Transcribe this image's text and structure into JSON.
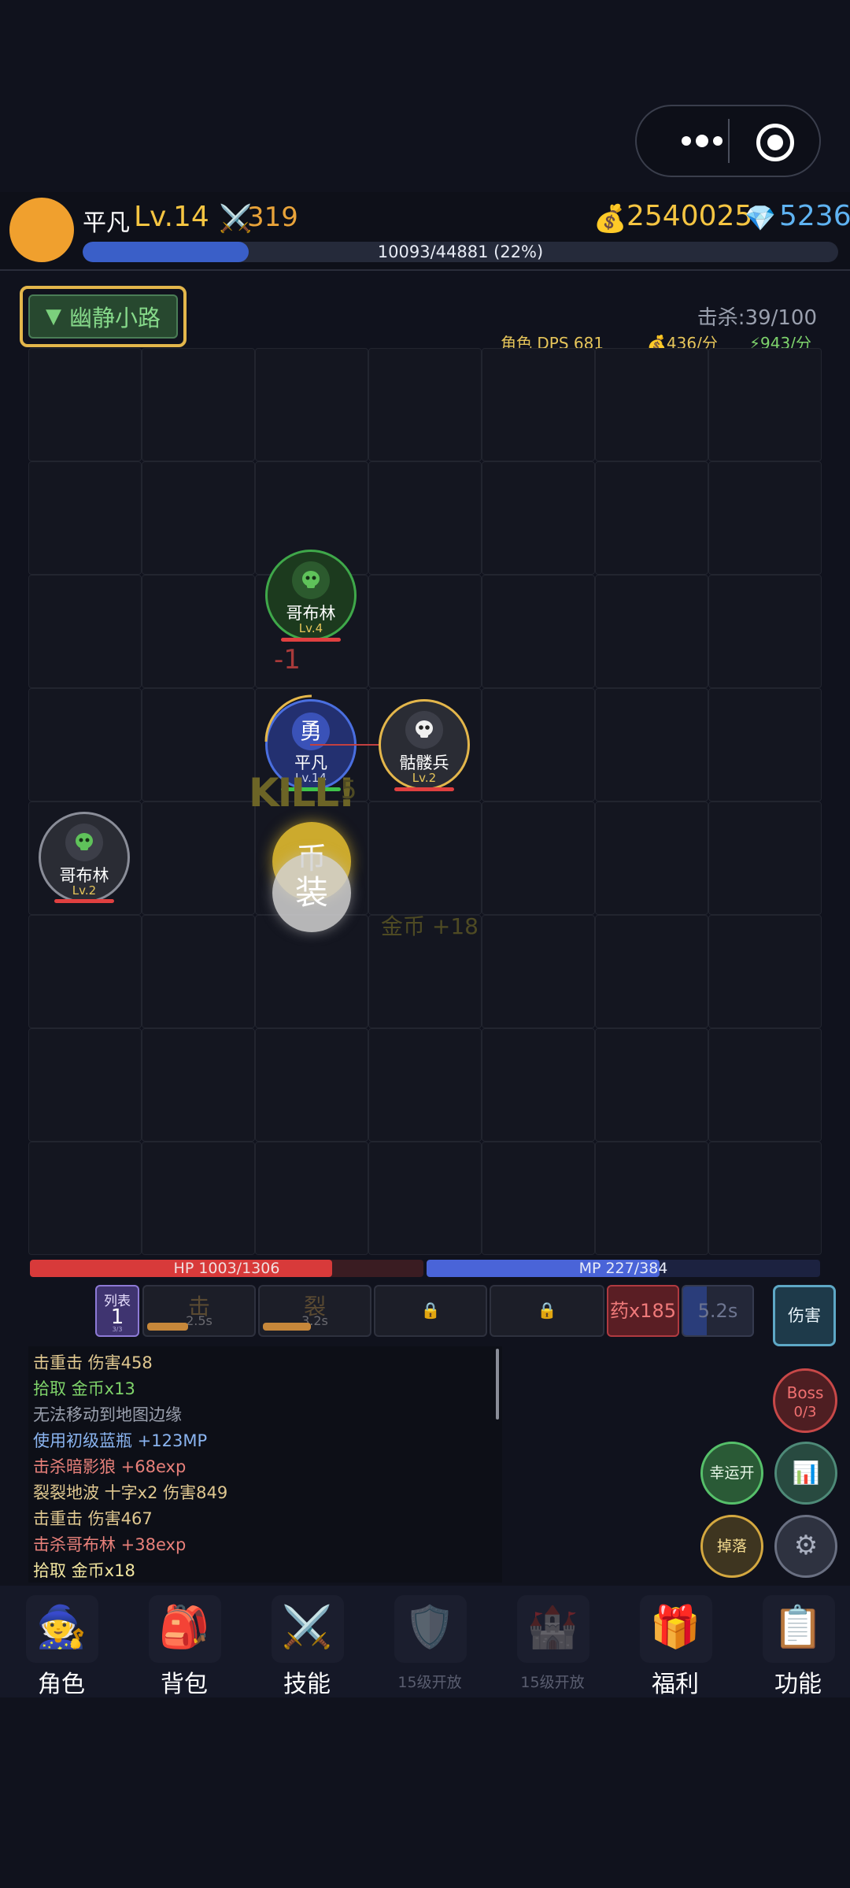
{
  "player": {
    "name": "平凡",
    "level": "Lv.14",
    "attack_icon": "⚔️",
    "attack": "319",
    "gold_icon": "💰",
    "gold": "2540025",
    "gem_icon": "💎",
    "gems": "5236",
    "xp_text": "10093/44881 (22%)",
    "xp_fraction": 0.22
  },
  "map": {
    "arrow": "▼",
    "name": "幽静小路",
    "kills": "击杀:39/100",
    "dps": "角色 DPS 681",
    "gold_rate": "💰436/分",
    "exp_rate": "⚡943/分"
  },
  "units": {
    "goblin1": {
      "name": "哥布林",
      "level": "Lv.4",
      "icon": "goblin-skull-icon"
    },
    "hero": {
      "badge": "勇",
      "name": "平凡",
      "level": "Lv.14"
    },
    "skeleton": {
      "name": "骷髅兵",
      "level": "Lv.2",
      "icon": "skull-icon"
    },
    "goblin2": {
      "name": "哥布林",
      "level": "Lv.2",
      "icon": "goblin-skull-icon"
    }
  },
  "effects": {
    "damage_float": "-1",
    "kill_text": "KILL!",
    "kill_num": "5",
    "coin_drop": "币",
    "equip_drop": "装",
    "gold_float": "金币 +18"
  },
  "bars": {
    "hp_text": "HP 1003/1306",
    "hp_fraction": 0.768,
    "mp_text": "MP 227/384",
    "mp_fraction": 0.591
  },
  "skills": {
    "list_label": "列表",
    "list_num": "1",
    "list_small": "3/3",
    "s1_name": "击",
    "s1_cd": "2.5s",
    "s1_progress": 0.38,
    "s2_name": "裂",
    "s2_cd": "3.2s",
    "s2_progress": 0.45,
    "lock": "🔒",
    "potion": "药x185",
    "cd": "5.2s",
    "damage_btn": "伤害"
  },
  "log": [
    {
      "text": "击重击 伤害458",
      "color": "#e0c890"
    },
    {
      "text": "拾取 金币x13",
      "color": "#7fd46a"
    },
    {
      "text": "无法移动到地图边缘",
      "color": "#9aa0ae"
    },
    {
      "text": "使用初级蓝瓶 +123MP",
      "color": "#8ab4f0"
    },
    {
      "text": "击杀暗影狼 +68exp",
      "color": "#e8807a"
    },
    {
      "text": "裂裂地波 十字x2 伤害849",
      "color": "#e0c890"
    },
    {
      "text": "击重击 伤害467",
      "color": "#e0c890"
    },
    {
      "text": "击杀哥布林 +38exp",
      "color": "#e8807a"
    },
    {
      "text": "拾取 金币x18",
      "color": "#f2e6a0"
    }
  ],
  "side_buttons": {
    "boss_label": "Boss",
    "boss_count": "0/3",
    "luck": "幸运开",
    "stats_icon": "📊",
    "drops": "掉落",
    "settings_icon": "⚙"
  },
  "nav": [
    {
      "label": "角色",
      "icon": "🧙",
      "locked": false
    },
    {
      "label": "背包",
      "icon": "🎒",
      "locked": false
    },
    {
      "label": "技能",
      "icon": "⚔️",
      "locked": false
    },
    {
      "label": "15级开放",
      "icon": "🛡️",
      "locked": true
    },
    {
      "label": "15级开放",
      "icon": "🏰",
      "locked": true
    },
    {
      "label": "福利",
      "icon": "🎁",
      "locked": false
    },
    {
      "label": "功能",
      "icon": "📋",
      "locked": false
    }
  ],
  "colors": {
    "background": "#10121d",
    "gold": "#f5c542",
    "hp": "#d83a3a",
    "mp": "#4a64d8",
    "xp": "#3a5fc8"
  }
}
